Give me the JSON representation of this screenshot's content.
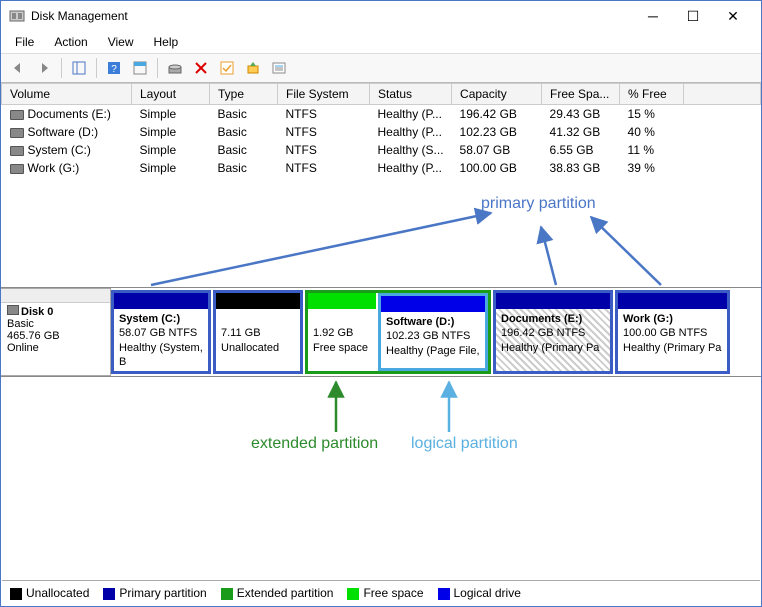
{
  "window": {
    "title": "Disk Management"
  },
  "menu": {
    "file": "File",
    "action": "Action",
    "view": "View",
    "help": "Help"
  },
  "columns": {
    "volume": "Volume",
    "layout": "Layout",
    "type": "Type",
    "fs": "File System",
    "status": "Status",
    "capacity": "Capacity",
    "free": "Free Spa...",
    "pctfree": "% Free"
  },
  "volumes": [
    {
      "name": "Documents (E:)",
      "layout": "Simple",
      "type": "Basic",
      "fs": "NTFS",
      "status": "Healthy (P...",
      "capacity": "196.42 GB",
      "free": "29.43 GB",
      "pct": "15 %"
    },
    {
      "name": "Software (D:)",
      "layout": "Simple",
      "type": "Basic",
      "fs": "NTFS",
      "status": "Healthy (P...",
      "capacity": "102.23 GB",
      "free": "41.32 GB",
      "pct": "40 %"
    },
    {
      "name": "System (C:)",
      "layout": "Simple",
      "type": "Basic",
      "fs": "NTFS",
      "status": "Healthy (S...",
      "capacity": "58.07 GB",
      "free": "6.55 GB",
      "pct": "11 %"
    },
    {
      "name": "Work (G:)",
      "layout": "Simple",
      "type": "Basic",
      "fs": "NTFS",
      "status": "Healthy (P...",
      "capacity": "100.00 GB",
      "free": "38.83 GB",
      "pct": "39 %"
    }
  ],
  "disk": {
    "label": "Disk 0",
    "type": "Basic",
    "size": "465.76 GB",
    "status": "Online"
  },
  "partitions": {
    "system": {
      "name": "System  (C:)",
      "line2": "58.07 GB NTFS",
      "line3": "Healthy (System, B"
    },
    "unalloc": {
      "line2": "7.11 GB",
      "line3": "Unallocated"
    },
    "free": {
      "line2": "1.92 GB",
      "line3": "Free space"
    },
    "software": {
      "name": "Software  (D:)",
      "line2": "102.23 GB NTFS",
      "line3": "Healthy (Page File,"
    },
    "documents": {
      "name": "Documents  (E:)",
      "line2": "196.42 GB NTFS",
      "line3": "Healthy (Primary Pa"
    },
    "work": {
      "name": "Work  (G:)",
      "line2": "100.00 GB NTFS",
      "line3": "Healthy (Primary Pa"
    }
  },
  "annotations": {
    "primary": "primary partition",
    "extended": "extended partition",
    "logical": "logical partition"
  },
  "legend": {
    "unalloc": "Unallocated",
    "primary": "Primary partition",
    "extended": "Extended partition",
    "free": "Free space",
    "logical": "Logical drive"
  },
  "colors": {
    "primary_blue": "#3b5cc4",
    "dark_blue": "#0000a8",
    "green": "#1a9c1a",
    "lime": "#00e000",
    "logical_blue": "#4aa8e0",
    "anno_primary": "#4a76c6",
    "anno_extended": "#2d8a2d",
    "anno_logical": "#5ab0e0"
  }
}
